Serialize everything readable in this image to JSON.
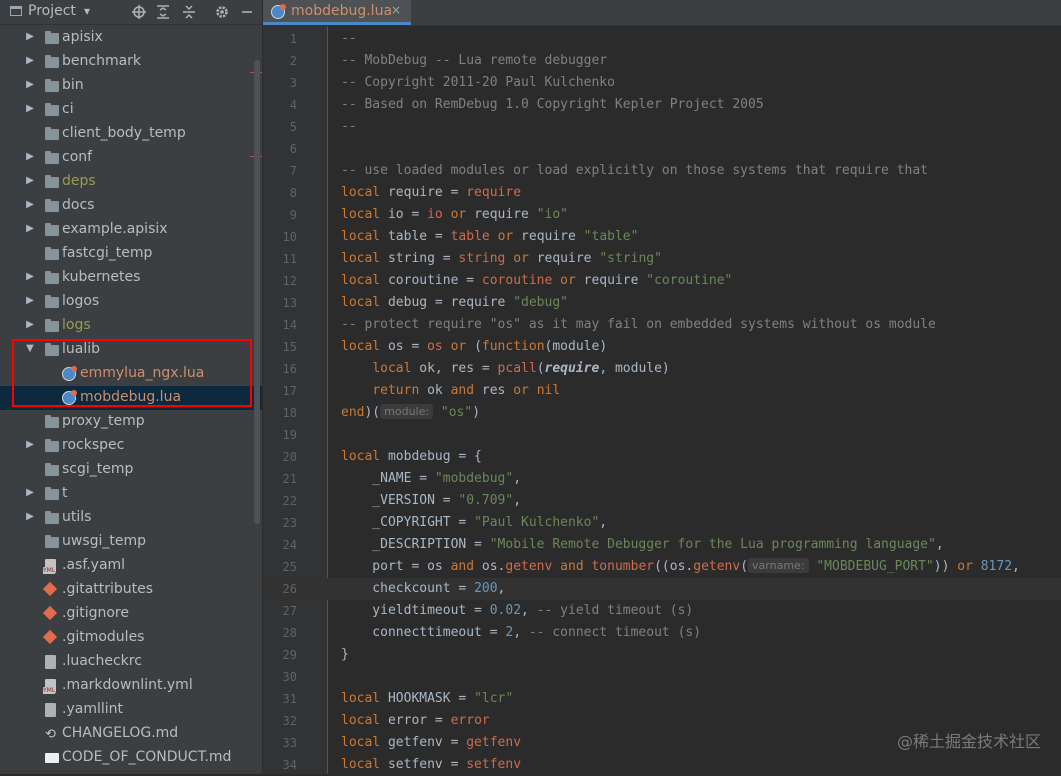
{
  "project": {
    "title": "Project",
    "caret": "▾",
    "icons": [
      "locate-icon",
      "expand-all-icon",
      "collapse-all-icon",
      "gear-icon",
      "minimize-icon"
    ]
  },
  "tree": [
    {
      "name": "apisix",
      "type": "folder",
      "expandable": true,
      "state": "normal"
    },
    {
      "name": "benchmark",
      "type": "folder",
      "expandable": true,
      "state": "normal"
    },
    {
      "name": "bin",
      "type": "folder",
      "expandable": true,
      "state": "normal"
    },
    {
      "name": "ci",
      "type": "folder",
      "expandable": true,
      "state": "normal"
    },
    {
      "name": "client_body_temp",
      "type": "folder",
      "expandable": false,
      "state": "normal"
    },
    {
      "name": "conf",
      "type": "folder",
      "expandable": true,
      "state": "normal"
    },
    {
      "name": "deps",
      "type": "folder",
      "expandable": true,
      "state": "excluded"
    },
    {
      "name": "docs",
      "type": "folder",
      "expandable": true,
      "state": "normal"
    },
    {
      "name": "example.apisix",
      "type": "folder",
      "expandable": true,
      "state": "normal"
    },
    {
      "name": "fastcgi_temp",
      "type": "folder",
      "expandable": false,
      "state": "normal"
    },
    {
      "name": "kubernetes",
      "type": "folder",
      "expandable": true,
      "state": "normal"
    },
    {
      "name": "logos",
      "type": "folder",
      "expandable": true,
      "state": "normal"
    },
    {
      "name": "logs",
      "type": "folder",
      "expandable": true,
      "state": "excluded"
    },
    {
      "name": "lualib",
      "type": "folder",
      "expandable": true,
      "expanded": true,
      "state": "normal"
    },
    {
      "name": "emmylua_ngx.lua",
      "type": "lua",
      "indent": 1,
      "state": "modified"
    },
    {
      "name": "mobdebug.lua",
      "type": "lua",
      "indent": 1,
      "state": "modified",
      "selected": true
    },
    {
      "name": "proxy_temp",
      "type": "folder",
      "expandable": false,
      "state": "normal"
    },
    {
      "name": "rockspec",
      "type": "folder",
      "expandable": true,
      "state": "normal"
    },
    {
      "name": "scgi_temp",
      "type": "folder",
      "expandable": false,
      "state": "normal"
    },
    {
      "name": "t",
      "type": "folder",
      "expandable": true,
      "state": "normal"
    },
    {
      "name": "utils",
      "type": "folder",
      "expandable": true,
      "state": "normal"
    },
    {
      "name": "uwsgi_temp",
      "type": "folder",
      "expandable": false,
      "state": "normal"
    },
    {
      "name": ".asf.yaml",
      "type": "yml",
      "state": "normal"
    },
    {
      "name": ".gitattributes",
      "type": "git",
      "state": "normal"
    },
    {
      "name": ".gitignore",
      "type": "git",
      "state": "normal"
    },
    {
      "name": ".gitmodules",
      "type": "git",
      "state": "normal"
    },
    {
      "name": ".luacheckrc",
      "type": "file",
      "state": "normal"
    },
    {
      "name": ".markdownlint.yml",
      "type": "yml",
      "state": "normal"
    },
    {
      "name": ".yamllint",
      "type": "file",
      "state": "normal"
    },
    {
      "name": "CHANGELOG.md",
      "type": "changelog",
      "state": "normal"
    },
    {
      "name": "CODE_OF_CONDUCT.md",
      "type": "md",
      "state": "normal"
    }
  ],
  "tab": {
    "label": "mobdebug.lua",
    "close": "×"
  },
  "editor": {
    "current_line": 26,
    "lines": [
      {
        "n": "1",
        "t": [
          [
            "c",
            "--"
          ]
        ]
      },
      {
        "n": "2",
        "t": [
          [
            "c",
            "-- MobDebug -- Lua remote debugger"
          ]
        ]
      },
      {
        "n": "3",
        "t": [
          [
            "c",
            "-- Copyright 2011-20 Paul Kulchenko"
          ]
        ]
      },
      {
        "n": "4",
        "t": [
          [
            "c",
            "-- Based on RemDebug 1.0 Copyright Kepler Project 2005"
          ]
        ]
      },
      {
        "n": "5",
        "t": [
          [
            "c",
            "--"
          ]
        ]
      },
      {
        "n": "6",
        "t": []
      },
      {
        "n": "7",
        "t": [
          [
            "c",
            "-- use loaded modules or load explicitly on those systems that require that"
          ]
        ]
      },
      {
        "n": "8",
        "t": [
          [
            "kw",
            "local"
          ],
          [
            "p",
            " require = "
          ],
          [
            "b",
            "require"
          ]
        ]
      },
      {
        "n": "9",
        "t": [
          [
            "kw",
            "local"
          ],
          [
            "p",
            " io = "
          ],
          [
            "b",
            "io"
          ],
          [
            "p",
            " "
          ],
          [
            "kw",
            "or"
          ],
          [
            "p",
            " require "
          ],
          [
            "s",
            "\"io\""
          ]
        ]
      },
      {
        "n": "10",
        "t": [
          [
            "kw",
            "local"
          ],
          [
            "p",
            " table = "
          ],
          [
            "b",
            "table"
          ],
          [
            "p",
            " "
          ],
          [
            "kw",
            "or"
          ],
          [
            "p",
            " require "
          ],
          [
            "s",
            "\"table\""
          ]
        ]
      },
      {
        "n": "11",
        "t": [
          [
            "kw",
            "local"
          ],
          [
            "p",
            " string = "
          ],
          [
            "b",
            "string"
          ],
          [
            "p",
            " "
          ],
          [
            "kw",
            "or"
          ],
          [
            "p",
            " require "
          ],
          [
            "s",
            "\"string\""
          ]
        ]
      },
      {
        "n": "12",
        "t": [
          [
            "kw",
            "local"
          ],
          [
            "p",
            " coroutine = "
          ],
          [
            "b",
            "coroutine"
          ],
          [
            "p",
            " "
          ],
          [
            "kw",
            "or"
          ],
          [
            "p",
            " require "
          ],
          [
            "s",
            "\"coroutine\""
          ]
        ]
      },
      {
        "n": "13",
        "t": [
          [
            "kw",
            "local"
          ],
          [
            "p",
            " debug = require "
          ],
          [
            "s",
            "\"debug\""
          ]
        ]
      },
      {
        "n": "14",
        "t": [
          [
            "c",
            "-- protect require \"os\" as it may fail on embedded systems without os module"
          ]
        ]
      },
      {
        "n": "15",
        "t": [
          [
            "kw",
            "local"
          ],
          [
            "p",
            " os = "
          ],
          [
            "b",
            "os"
          ],
          [
            "p",
            " "
          ],
          [
            "kw",
            "or"
          ],
          [
            "p",
            " ("
          ],
          [
            "kw",
            "function"
          ],
          [
            "p",
            "(module)"
          ]
        ]
      },
      {
        "n": "16",
        "t": [
          [
            "p",
            "    "
          ],
          [
            "kw",
            "local"
          ],
          [
            "p",
            " ok, res = "
          ],
          [
            "b",
            "pcall"
          ],
          [
            "p",
            "("
          ],
          [
            "it",
            "require"
          ],
          [
            "p",
            ", module)"
          ]
        ]
      },
      {
        "n": "17",
        "t": [
          [
            "p",
            "    "
          ],
          [
            "kw",
            "return"
          ],
          [
            "p",
            " ok "
          ],
          [
            "kw",
            "and"
          ],
          [
            "p",
            " res "
          ],
          [
            "kw",
            "or"
          ],
          [
            "p",
            " "
          ],
          [
            "kw",
            "nil"
          ]
        ]
      },
      {
        "n": "18",
        "t": [
          [
            "kw",
            "end"
          ],
          [
            "p",
            ")("
          ],
          [
            "h",
            "module:"
          ],
          [
            "p",
            " "
          ],
          [
            "s",
            "\"os\""
          ],
          [
            "p",
            ")"
          ]
        ]
      },
      {
        "n": "19",
        "t": []
      },
      {
        "n": "20",
        "t": [
          [
            "kw",
            "local"
          ],
          [
            "p",
            " mobdebug = {"
          ]
        ]
      },
      {
        "n": "21",
        "t": [
          [
            "p",
            "    _NAME = "
          ],
          [
            "s",
            "\"mobdebug\""
          ],
          [
            "p",
            ","
          ]
        ]
      },
      {
        "n": "22",
        "t": [
          [
            "p",
            "    _VERSION = "
          ],
          [
            "s",
            "\"0.709\""
          ],
          [
            "p",
            ","
          ]
        ]
      },
      {
        "n": "23",
        "t": [
          [
            "p",
            "    _COPYRIGHT = "
          ],
          [
            "s",
            "\"Paul Kulchenko\""
          ],
          [
            "p",
            ","
          ]
        ]
      },
      {
        "n": "24",
        "t": [
          [
            "p",
            "    _DESCRIPTION = "
          ],
          [
            "s",
            "\"Mobile Remote Debugger for the Lua programming language\""
          ],
          [
            "p",
            ","
          ]
        ]
      },
      {
        "n": "25",
        "t": [
          [
            "p",
            "    port = os "
          ],
          [
            "kw",
            "and"
          ],
          [
            "p",
            " os."
          ],
          [
            "b",
            "getenv"
          ],
          [
            "p",
            " "
          ],
          [
            "kw",
            "and"
          ],
          [
            "p",
            " "
          ],
          [
            "b",
            "tonumber"
          ],
          [
            "p",
            "((os."
          ],
          [
            "b",
            "getenv"
          ],
          [
            "p",
            "("
          ],
          [
            "h",
            "varname:"
          ],
          [
            "p",
            " "
          ],
          [
            "s",
            "\"MOBDEBUG_PORT\""
          ],
          [
            "p",
            ")) "
          ],
          [
            "kw",
            "or"
          ],
          [
            "p",
            " "
          ],
          [
            "n",
            "8172"
          ],
          [
            "p",
            ","
          ]
        ]
      },
      {
        "n": "26",
        "t": [
          [
            "p",
            "    checkcount = "
          ],
          [
            "n",
            "200"
          ],
          [
            "p",
            ","
          ]
        ]
      },
      {
        "n": "27",
        "t": [
          [
            "p",
            "    yieldtimeout = "
          ],
          [
            "n",
            "0.02"
          ],
          [
            "p",
            ", "
          ],
          [
            "c",
            "-- yield timeout (s)"
          ]
        ]
      },
      {
        "n": "28",
        "t": [
          [
            "p",
            "    connecttimeout = "
          ],
          [
            "n",
            "2"
          ],
          [
            "p",
            ", "
          ],
          [
            "c",
            "-- connect timeout (s)"
          ]
        ]
      },
      {
        "n": "29",
        "t": [
          [
            "p",
            "}"
          ]
        ]
      },
      {
        "n": "30",
        "t": []
      },
      {
        "n": "31",
        "t": [
          [
            "kw",
            "local"
          ],
          [
            "p",
            " HOOKMASK = "
          ],
          [
            "s",
            "\"lcr\""
          ]
        ]
      },
      {
        "n": "32",
        "t": [
          [
            "kw",
            "local"
          ],
          [
            "p",
            " error = "
          ],
          [
            "b",
            "error"
          ]
        ]
      },
      {
        "n": "33",
        "t": [
          [
            "kw",
            "local"
          ],
          [
            "p",
            " getfenv = "
          ],
          [
            "b",
            "getfenv"
          ]
        ]
      },
      {
        "n": "34",
        "t": [
          [
            "kw",
            "local"
          ],
          [
            "p",
            " setfenv = "
          ],
          [
            "b",
            "setfenv"
          ]
        ]
      }
    ]
  },
  "watermark": "@稀土掘金技术社区",
  "colors": {
    "keyword": "#cc7832",
    "comment": "#808080",
    "string": "#6a8759",
    "number": "#6897bb",
    "builtin": "#cf6a4c",
    "selection_box": "#ff0000"
  }
}
